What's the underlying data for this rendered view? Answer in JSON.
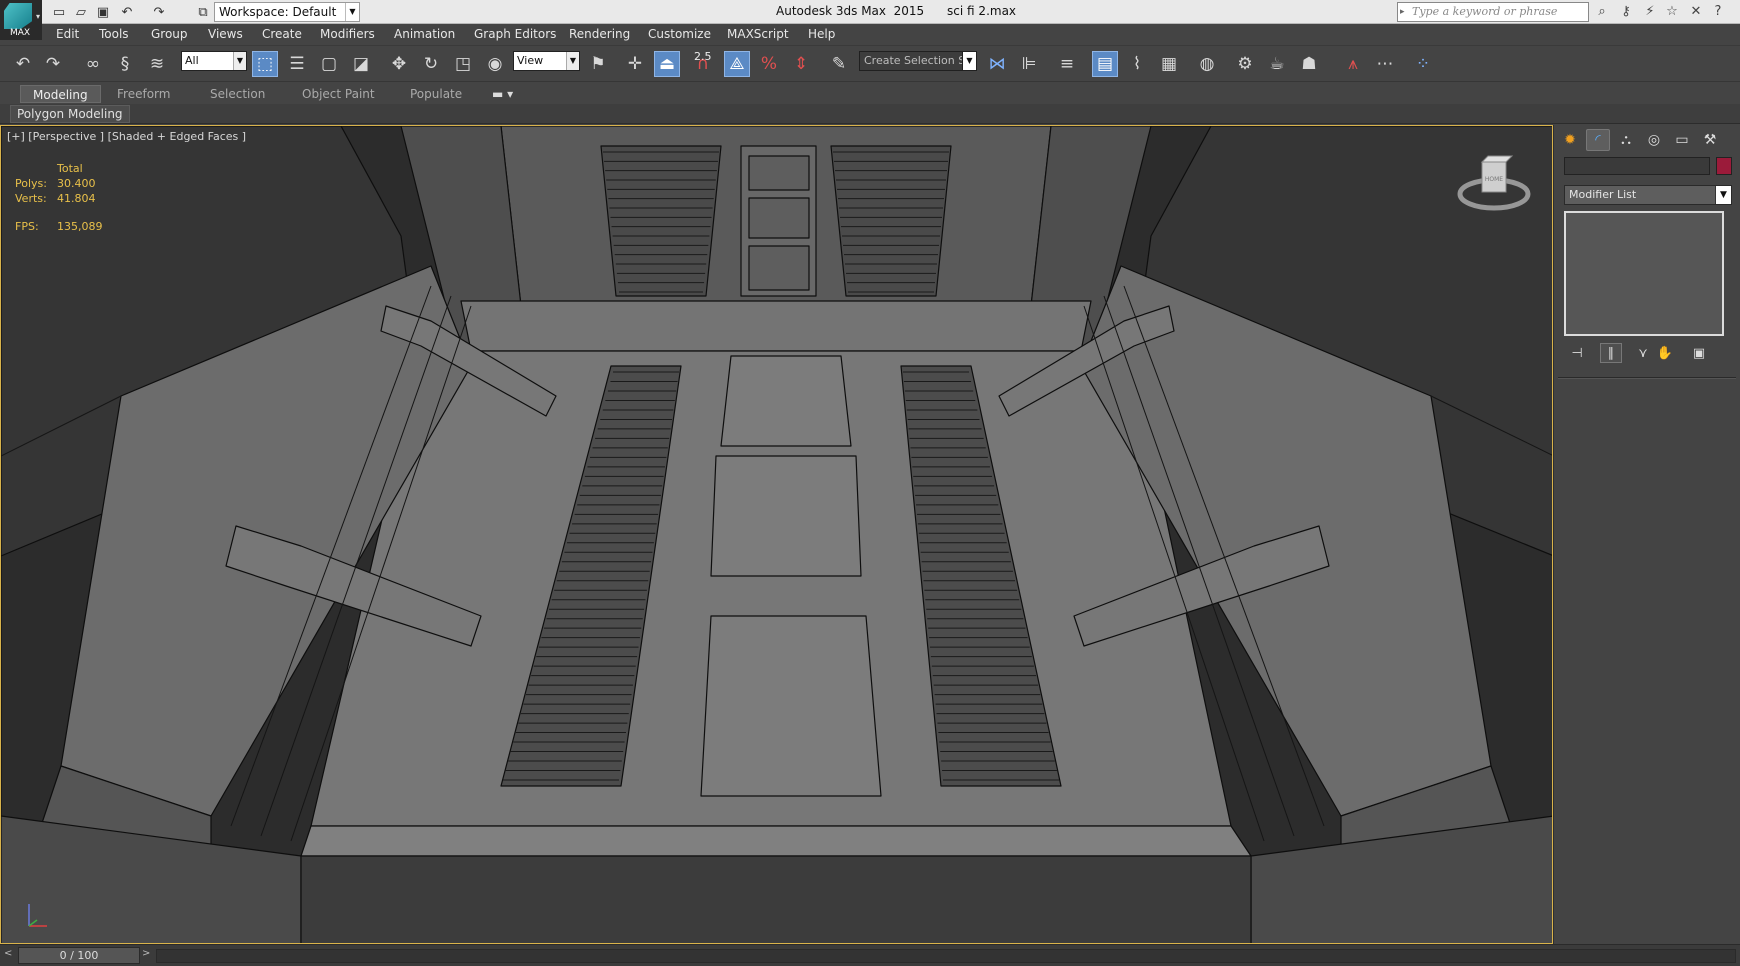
{
  "title_bar": {
    "app_logo_text": "MAX",
    "workspace_label": "Workspace: Default",
    "app_title": "Autodesk 3ds Max  2015      sci fi 2.max",
    "search_placeholder": "Type a keyword or phrase"
  },
  "menu": [
    "Edit",
    "Tools",
    "Group",
    "Views",
    "Create",
    "Modifiers",
    "Animation",
    "Graph Editors",
    "Rendering",
    "Customize",
    "MAXScript",
    "Help"
  ],
  "main_toolbar": {
    "selection_filter": "All",
    "ref_coord": "View",
    "snap_angle_label": "2.5",
    "named_selection_placeholder": "Create Selection Se"
  },
  "ribbon": {
    "tabs": [
      "Modeling",
      "Freeform",
      "Selection",
      "Object Paint",
      "Populate"
    ],
    "active_tab": "Modeling",
    "panel_label": "Polygon Modeling"
  },
  "viewport": {
    "label": "[+] [Perspective ] [Shaded + Edged Faces ]",
    "stats": {
      "total_label": "Total",
      "polys_label": "Polys:",
      "polys_value": "30.400",
      "verts_label": "Verts:",
      "verts_value": "41.804",
      "fps_label": "FPS:",
      "fps_value": "135,089"
    },
    "viewcube_label": "HOME",
    "border_color": "#d9b34b"
  },
  "command_panel": {
    "modifier_list": "Modifier List",
    "object_color": "#9b1b3a"
  },
  "time_slider": {
    "frame": "0 / 100"
  }
}
